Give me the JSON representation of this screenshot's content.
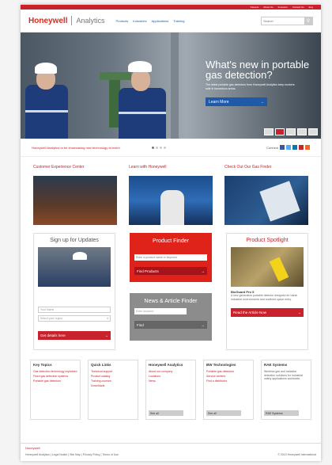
{
  "topbar": {
    "links": [
      "Careers",
      "About Us",
      "Investors",
      "Contact Us",
      "Eng"
    ]
  },
  "header": {
    "logo": "Honeywell",
    "sublogo": "Analytics",
    "nav": [
      "Products",
      "Industries",
      "Applications",
      "Training"
    ],
    "search_placeholder": "Search"
  },
  "hero": {
    "title": "What's new in portable gas detection?",
    "body": "The latest portable gas detectors from Honeywell Analytics keep workers safe in hazardous areas.",
    "button": "Learn More"
  },
  "news": {
    "text": "Honeywell Analytics to be showcasing new technology at event",
    "connect_label": "Connect"
  },
  "sections": [
    {
      "title": "Customer Experience Center"
    },
    {
      "title": "Learn with Honeywell"
    },
    {
      "title": "Check Out Our Gas Finder"
    }
  ],
  "signup": {
    "title": "Sign up for Updates",
    "name_placeholder": "Your Name",
    "select_label": "Select your region",
    "button": "Get details here"
  },
  "product_finder": {
    "title": "Product Finder",
    "placeholder": "Enter a product name or keyword",
    "button": "Find Products"
  },
  "news_finder": {
    "title": "News & Article Finder",
    "placeholder": "Enter keyword",
    "button": "Find"
  },
  "spotlight": {
    "title": "Product Spotlight",
    "name": "BioGuard Pro 5",
    "description": "A new generation portable detector designed for harsh industrial environments and confined space entry.",
    "button": "Read the Article Now"
  },
  "footer_cols": [
    {
      "heading": "Key Topics",
      "links": [
        "Gas detection technology explained",
        "Fixed gas detection systems",
        "Portable gas detectors"
      ],
      "button": ""
    },
    {
      "heading": "Quick Links",
      "links": [
        "Technical support",
        "Product catalog",
        "Training courses",
        "Downloads"
      ],
      "button": ""
    },
    {
      "heading": "Honeywell Analytics",
      "links": [
        "About our company",
        "Locations",
        "News"
      ],
      "button": "See all"
    },
    {
      "heading": "BW Technologies",
      "links": [
        "Portable gas detectors",
        "Service centers",
        "Find a distributor"
      ],
      "button": "See all"
    },
    {
      "heading": "RAE Systems",
      "text": "Wireless gas and radiation detection solutions for industrial safety applications worldwide.",
      "button": "RAE Systems"
    }
  ],
  "bottom": {
    "brand": "Honeywell",
    "links": "Honeywell Analytics | Legal Notice | Site Map | Privacy Policy | Terms of Use",
    "copyright": "© 2013 Honeywell International"
  }
}
